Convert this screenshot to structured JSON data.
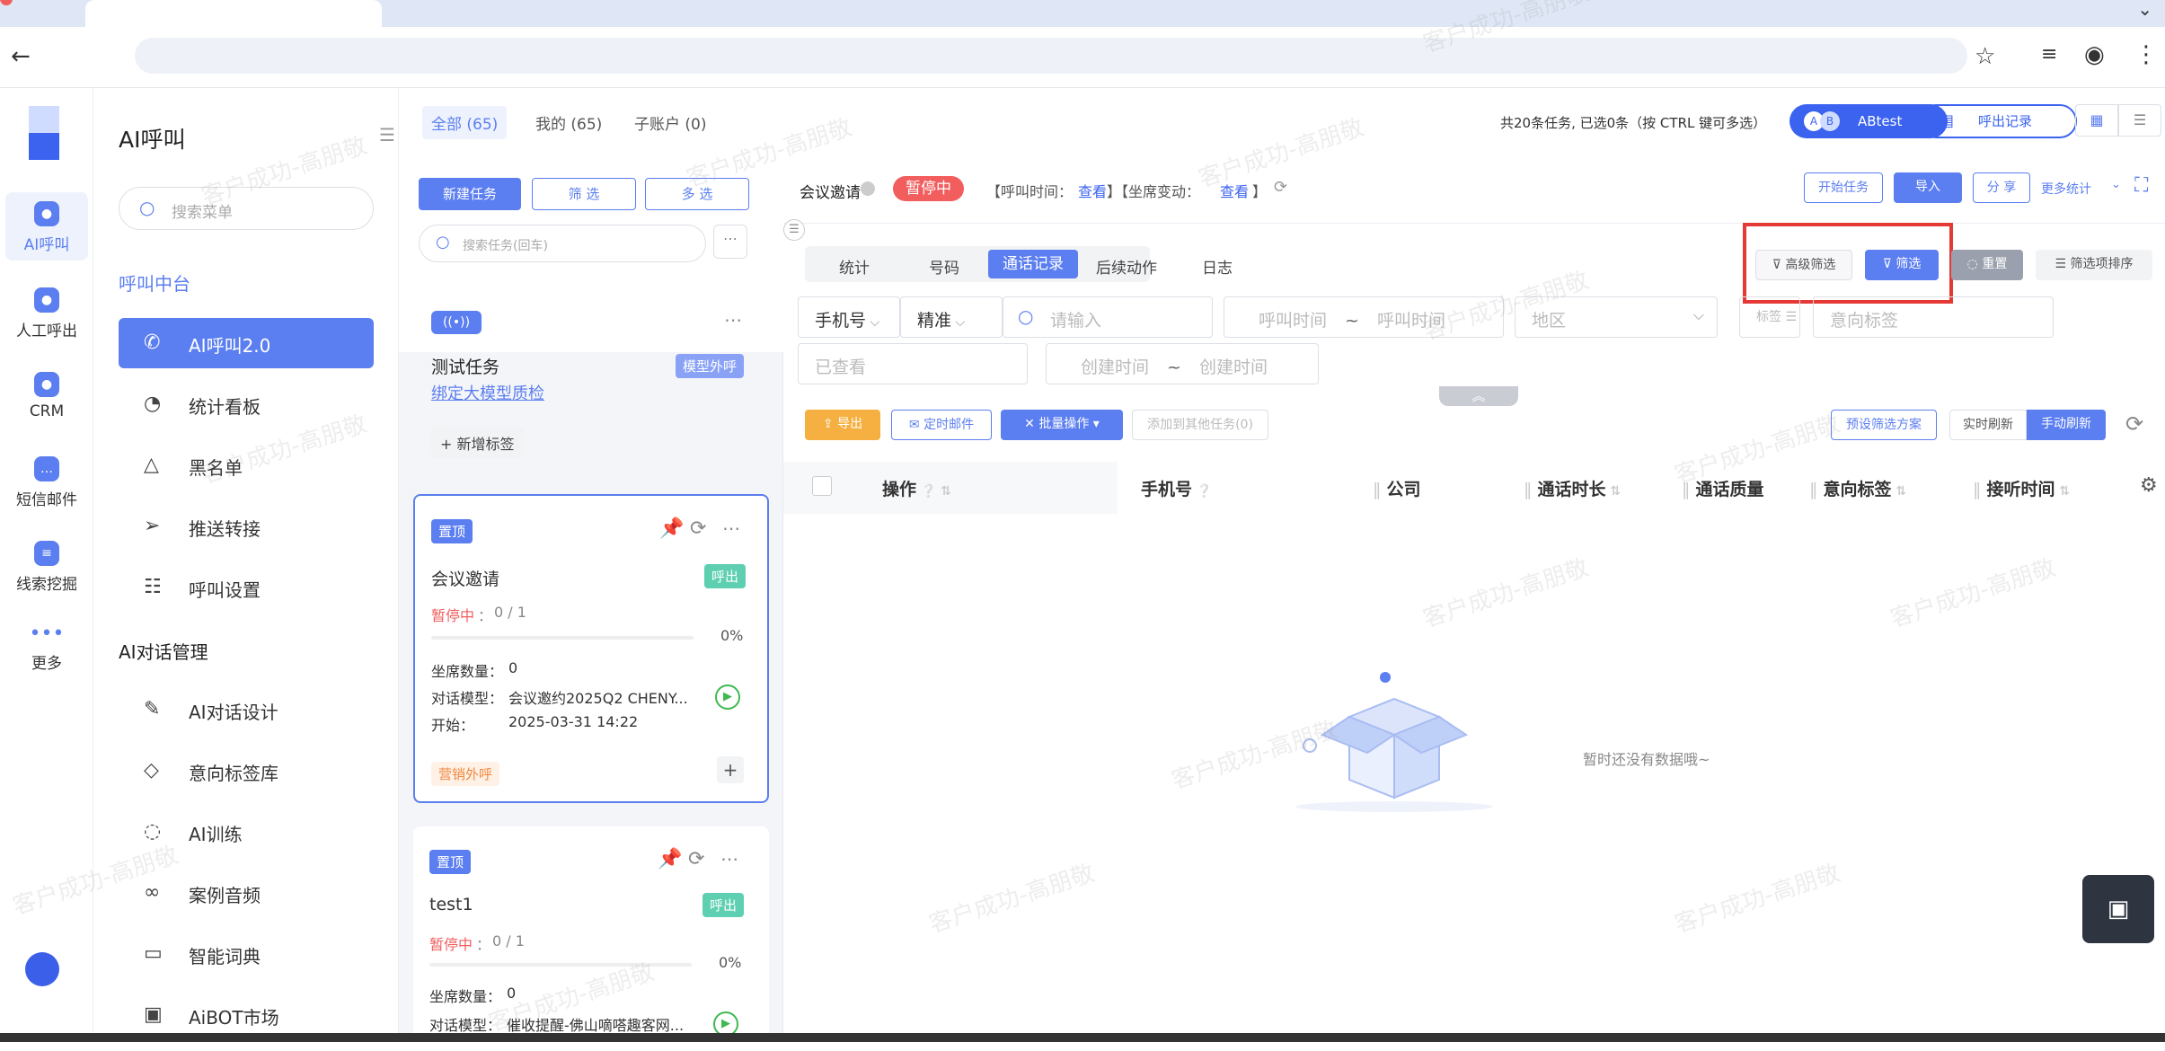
{
  "top_tabs": {
    "selected": "AI呼叫"
  },
  "rail": {
    "items": [
      {
        "label": "AI呼叫"
      },
      {
        "label": "人工呼出"
      },
      {
        "label": "CRM"
      },
      {
        "label": "短信邮件"
      },
      {
        "label": "线索挖掘"
      },
      {
        "label": "更多"
      }
    ]
  },
  "menu": {
    "title": "AI呼叫",
    "search_placeholder": "搜索菜单",
    "section1": "呼叫中台",
    "section2": "AI对话管理",
    "items1": [
      "AI呼叫2.0",
      "统计看板",
      "黑名单",
      "推送转接",
      "呼叫设置"
    ],
    "items2": [
      "AI对话设计",
      "意向标签库",
      "AI训练",
      "案例音频",
      "智能词典",
      "AiBOT市场"
    ]
  },
  "tasks": {
    "tabs": [
      "全部 (65)",
      "我的 (65)",
      "子账户 (0)"
    ],
    "new_task": "新建任务",
    "filter": "筛 选",
    "multi": "多 选",
    "search_placeholder": "搜索任务(回车)",
    "card0": {
      "title": "测试任务",
      "tag": "模型外呼",
      "link": "绑定大模型质检",
      "add_tag": "+ 新增标签"
    },
    "card1": {
      "pin": "置顶",
      "title": "会议邀请",
      "type": "呼出",
      "status": "暂停中",
      "progress": "0 / 1",
      "percent": "0%",
      "progress_value": 0,
      "seats_label": "坐席数量：",
      "seats": "0",
      "model_label": "对话模型：",
      "model": "会议邀约2025Q2 CHENY...",
      "start_label": "开始：",
      "start": "2025-03-31 14:22",
      "foot_tag": "营销外呼",
      "plus": "+"
    },
    "card2": {
      "pin": "置顶",
      "title": "test1",
      "type": "呼出",
      "status": "暂停中",
      "progress": "0 / 1",
      "percent": "0%",
      "progress_value": 0,
      "seats_label": "坐席数量：",
      "seats": "0",
      "model_label": "对话模型：",
      "model": "催收提醒-佛山嘀嗒趣客网..."
    }
  },
  "main": {
    "summary": "共20条任务, 已选0条（按 CTRL 键可多选）",
    "abtest": "ABtest",
    "call_records": "呼出记录",
    "task_name": "会议邀请",
    "status_badge": "暂停中",
    "call_time_label": "【呼叫时间：",
    "view1": "查看",
    "seat_label": "】【坐席变动：",
    "view2": "查看",
    "close_bracket": "】",
    "start_task": "开始任务",
    "import": "导入",
    "share": "分 享",
    "more_stats": "更多统计",
    "tabs": [
      "统计",
      "号码",
      "通话记录",
      "后续动作",
      "日志"
    ],
    "active_tab": "通话记录",
    "adv_filter": "高级筛选",
    "filter": "筛选",
    "reset": "重置",
    "sort_filter": "筛选项排序",
    "phone_select": "手机号",
    "precise": "精准",
    "input_placeholder": "请输入",
    "call_time_from": "呼叫时间",
    "tilde": "~",
    "call_time_to": "呼叫时间",
    "region": "地区",
    "tag": "标签",
    "intent_tag": "意向标签",
    "viewed": "已查看",
    "create_from": "创建时间",
    "create_to": "创建时间",
    "export": "导出",
    "scheduled_email": "定时邮件",
    "batch_ops": "批量操作",
    "add_to_other": "添加到其他任务(0)",
    "preset": "预设筛选方案",
    "realtime": "实时刷新",
    "manual": "手动刷新",
    "columns": [
      "操作",
      "手机号",
      "公司",
      "通话时长",
      "通话质量",
      "意向标签",
      "接听时间"
    ],
    "empty": "暂时还没有数据哦~"
  },
  "watermark": "客户成功-高朋敬",
  "colors": {
    "accent": "#5b7ef0",
    "danger": "#f25d5d",
    "highlight": "#e53935",
    "orange": "#f5b041"
  }
}
